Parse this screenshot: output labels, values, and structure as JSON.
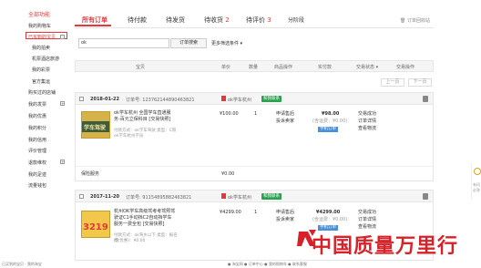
{
  "sidebar": {
    "section_all": "全部功能",
    "items": [
      {
        "label": "我的购物车"
      },
      {
        "label": "已买到的宝贝"
      },
      {
        "label": "我的拍卖"
      },
      {
        "label": "机票酒店旅游"
      },
      {
        "label": "我的彩票"
      },
      {
        "label": "官方集运"
      },
      {
        "label": "购买过的店铺"
      },
      {
        "label": "我的发票"
      },
      {
        "label": "我的优惠"
      },
      {
        "label": "我的积分"
      },
      {
        "label": "我的信用"
      },
      {
        "label": "评价管理"
      },
      {
        "label": "退款维权"
      },
      {
        "label": "我的足迹"
      },
      {
        "label": "流量钱包"
      }
    ]
  },
  "tabs": [
    {
      "label": "所有订单",
      "count": ""
    },
    {
      "label": "待付款",
      "count": ""
    },
    {
      "label": "待发货",
      "count": ""
    },
    {
      "label": "待收货",
      "count": "2"
    },
    {
      "label": "待评价",
      "count": "3"
    },
    {
      "label": "分阶段",
      "count": ""
    }
  ],
  "recycle_label": "订单回收站",
  "search": {
    "value": "ok",
    "button": "订单搜索",
    "more": "更多筛选条件"
  },
  "table_headers": {
    "goods": "宝贝",
    "price": "单价",
    "qty": "数量",
    "ops": "商品操作",
    "paid": "实付款",
    "status": "交易状态",
    "actions": "交易操作"
  },
  "pager": {
    "prev": "上一页",
    "next": "下一页"
  },
  "orders": [
    {
      "date": "2018-01-22",
      "order_no": "订单号: 123762144890463821",
      "shop": "ok学车杭州",
      "badge": "和我联系",
      "thumb_text": "学车驾驶",
      "title": "ok学车杭州 全国学车直通服务-百元立保科目 [交易快照]",
      "attr": "付款方式：ok学车驾驶  类型：C照",
      "seller": "ok学车杭州学员",
      "price": "¥100.00",
      "qty": "1",
      "op1": "申请售后",
      "op2": "投诉卖家",
      "paid": "¥98.00",
      "paid_note": "(含运费：¥0.00)",
      "paid_type": "手机订单",
      "status1": "交易成功",
      "status2": "订单详情",
      "status3": "查看物流",
      "extra_label": "保险服务",
      "extra_price": "¥0.00"
    },
    {
      "date": "2017-11-20",
      "order_no": "订单号: 91154895882463821",
      "shop": "ok学车杭州",
      "badge": "和我联系",
      "thumb_text": "3219",
      "title": "杭州OK学车高级驾考考驾照驾驶证C1手动挡C2自动挡学车服务一费全包 [交易快照]",
      "attr": "付款方式：ok驾乡以下  类型：报名费",
      "seller": "(含优惠)：¥0.00",
      "price": "¥4299.00",
      "qty": "1",
      "op1": "申请售后",
      "op2": "投诉卖家",
      "paid": "¥4299.00",
      "paid_note": "(含运费：¥0.00)",
      "paid_type": "手机订单",
      "status1": "交易成功",
      "status2": "订单详情",
      "status3": "查看物流"
    }
  ],
  "right_float": {
    "line1": "有问",
    "line2": "必答"
  },
  "watermark": "中国质量万里行",
  "statusbar": {
    "left": "已买到的宝贝 · 我的淘宝",
    "right": "● 淘宝网 ● 订单中心 ● 我的购物车 ● 联系客服"
  }
}
